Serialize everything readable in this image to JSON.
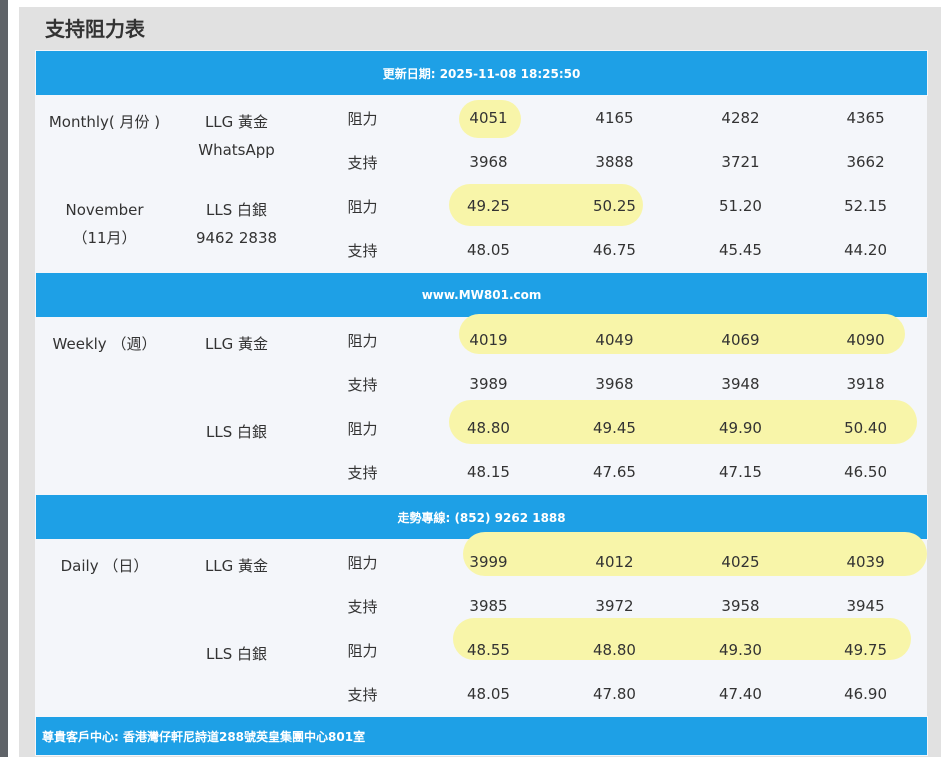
{
  "page": {
    "title": "支持阻力表"
  },
  "bands": {
    "update": "更新日期: 2025-11-08 18:25:50",
    "website": "www.MW801.com",
    "hotline": "走勢專線: (852) 9262 1888",
    "center": "尊貴客戶中心: 香港灣仔軒尼詩道288號英皇集團中心801室"
  },
  "labels": {
    "resistance": "阻力",
    "support": "支持"
  },
  "monthly": {
    "period_line1": "Monthly( 月份 )",
    "period_line2": "November",
    "period_line3": "（11月）",
    "gold_name": "LLG 黃金",
    "gold_sub": "WhatsApp",
    "silver_name": "LLS 白銀",
    "silver_sub": "9462 2838",
    "gold_resistance": [
      "4051",
      "4165",
      "4282",
      "4365"
    ],
    "gold_support": [
      "3968",
      "3888",
      "3721",
      "3662"
    ],
    "silver_resistance": [
      "49.25",
      "50.25",
      "51.20",
      "52.15"
    ],
    "silver_support": [
      "48.05",
      "46.75",
      "45.45",
      "44.20"
    ]
  },
  "weekly": {
    "period": "Weekly （週）",
    "gold_name": "LLG 黃金",
    "silver_name": "LLS 白銀",
    "gold_resistance": [
      "4019",
      "4049",
      "4069",
      "4090"
    ],
    "gold_support": [
      "3989",
      "3968",
      "3948",
      "3918"
    ],
    "silver_resistance": [
      "48.80",
      "49.45",
      "49.90",
      "50.40"
    ],
    "silver_support": [
      "48.15",
      "47.65",
      "47.15",
      "46.50"
    ]
  },
  "daily": {
    "period": "Daily （日）",
    "gold_name": "LLG 黃金",
    "silver_name": "LLS 白銀",
    "gold_resistance": [
      "3999",
      "4012",
      "4025",
      "4039"
    ],
    "gold_support": [
      "3985",
      "3972",
      "3958",
      "3945"
    ],
    "silver_resistance": [
      "48.55",
      "48.80",
      "49.30",
      "49.75"
    ],
    "silver_support": [
      "48.05",
      "47.80",
      "47.40",
      "46.90"
    ]
  },
  "colors": {
    "band": "#1ea0e6",
    "highlight": "#f8f5a9",
    "table_bg": "#f4f6fa",
    "page_bg": "#e1e1e1"
  }
}
